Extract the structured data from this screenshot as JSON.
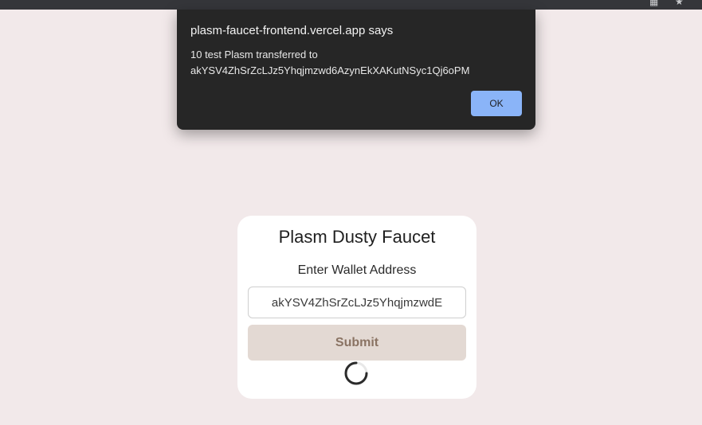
{
  "browser": {
    "reader_icon": "reader-mode-icon",
    "star_icon": "bookmark-star-icon"
  },
  "alert": {
    "title": "plasm-faucet-frontend.vercel.app says",
    "message_line1": "10 test Plasm transferred to",
    "message_line2": "akYSV4ZhSrZcLJz5Yhqjmzwd6AzynEkXAKutNSyc1Qj6oPM",
    "ok_label": "OK",
    "ok_color": "#8ab4f8"
  },
  "faucet": {
    "title": "Plasm Dusty Faucet",
    "address_label": "Enter Wallet Address",
    "address_value": "akYSV4ZhSrZcLJz5YhqjmzwdE",
    "submit_label": "Submit",
    "loading_icon": "loading-spinner-icon"
  },
  "colors": {
    "page_background": "#f2e9ea",
    "submit_background": "#e3d9d3",
    "submit_text": "#8a7363"
  }
}
